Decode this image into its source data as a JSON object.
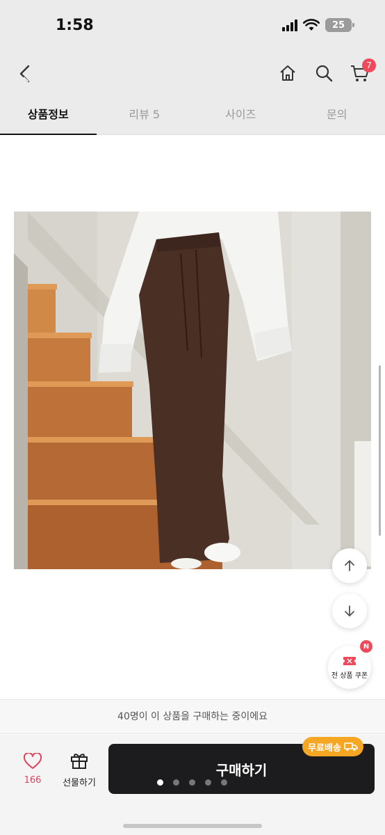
{
  "status_bar": {
    "time": "1:58",
    "battery": "25"
  },
  "header": {
    "back_icon": "chevron-left-icon",
    "home_icon": "home-icon",
    "search_icon": "search-icon",
    "cart_icon": "cart-icon",
    "cart_count": "7"
  },
  "tabs": [
    {
      "label": "상품정보",
      "active": true
    },
    {
      "label": "리뷰 5",
      "active": false
    },
    {
      "label": "사이즈",
      "active": false
    },
    {
      "label": "문의",
      "active": false
    }
  ],
  "floating": {
    "scroll_up_icon": "arrow-up-icon",
    "scroll_down_icon": "arrow-down-icon",
    "coupon_label": "전 상품 쿠폰",
    "coupon_badge": "N"
  },
  "notice": "40명이 이 상품을 구매하는 중이에요",
  "bottom_bar": {
    "like_count": "166",
    "gift_label": "선물하기",
    "buy_label": "구매하기",
    "shipping_badge": "무료배송",
    "page_dots": 5,
    "active_dot": 0
  },
  "colors": {
    "accent": "#ef4a5b",
    "buy_button": "#1c1c1e",
    "shipping_badge": "#f5a623",
    "skirt": "#4a2f24",
    "stairs": "#c77a3e"
  }
}
